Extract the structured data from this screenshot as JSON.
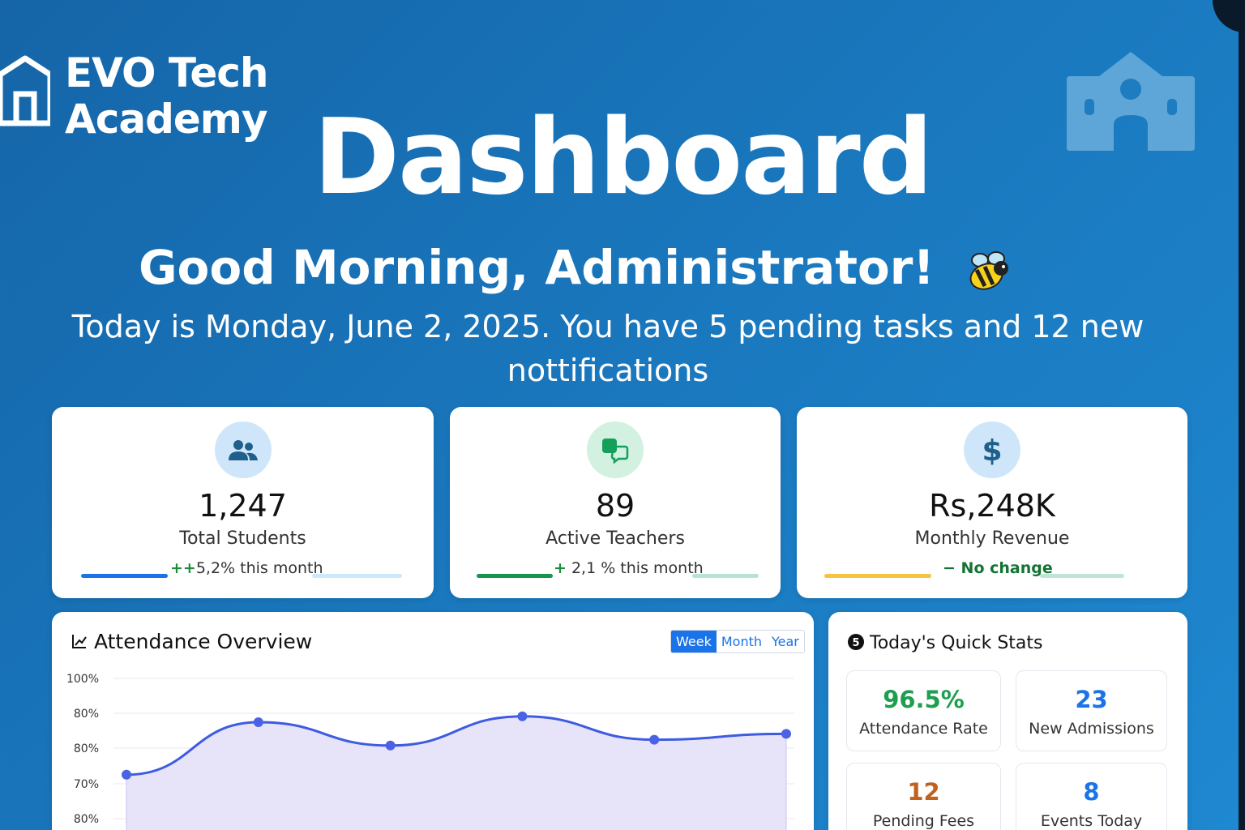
{
  "brand": {
    "line1": "EVO Tech",
    "line2": "Academy",
    "logo_icon": "home-icon"
  },
  "header": {
    "title": "Dashboard",
    "greeting": "Good Morning, Administrator!",
    "greeting_emoji": "bee-icon",
    "subtitle": "Today is Monday, June 2, 2025. You have 5 pending tasks and 12 new nottifications",
    "decor_icon": "school-building-icon"
  },
  "stats": [
    {
      "icon": "users-icon",
      "value": "1,247",
      "label": "Total Students",
      "change_symbol": "++",
      "change": "5,2% this month",
      "icon_bg": "#cfe6fa",
      "icon_color": "#1f5f8b",
      "bar_color": "#1a73e8",
      "bar_track": "#cde8f8",
      "change_color": "#1e8e3e"
    },
    {
      "icon": "chat-icon",
      "value": "89",
      "label": "Active Teachers",
      "change_symbol": "+",
      "change": " 2,1 % this month",
      "icon_bg": "#d2f1e1",
      "icon_color": "#15a05a",
      "bar_color": "#15964e",
      "bar_track": "#b7e3d4",
      "change_color": "#1e8e3e"
    },
    {
      "icon": "dollar-icon",
      "value": "Rs,248K",
      "label": "Monthly Revenue",
      "change_symbol": "−",
      "change": " No change",
      "icon_bg": "#cfe6fa",
      "icon_color": "#1f5f8b",
      "bar_color": "#f6c343",
      "bar_track": "#bfe6d5",
      "change_color": "#137333"
    }
  ],
  "attendance": {
    "title": "Attendance Overview",
    "title_icon": "line-chart-icon",
    "tabs": [
      {
        "label": "Week",
        "active": true
      },
      {
        "label": "Month",
        "active": false
      },
      {
        "label": "Year",
        "active": false
      }
    ]
  },
  "chart_data": {
    "type": "area",
    "title": "Attendance Overview",
    "y_tick_labels": [
      "100%",
      "80%",
      "80%",
      "70%",
      "80%"
    ],
    "values": [
      67,
      85,
      77,
      87,
      79,
      81
    ],
    "series_color": "#3d5ce0",
    "fill_color": "#e7e4fa",
    "grid": true
  },
  "quick_stats": {
    "title": "Today's Quick Stats",
    "title_icon": "number-5-badge-icon",
    "items": [
      {
        "value": "96.5%",
        "label": "Attendance Rate",
        "color": "#1e9e4f"
      },
      {
        "value": "23",
        "label": "New Admissions",
        "color": "#1a73e8"
      },
      {
        "value": "12",
        "label": "Pending Fees",
        "color": "#c0611e"
      },
      {
        "value": "8",
        "label": "Events Today",
        "color": "#1a73e8"
      }
    ]
  }
}
